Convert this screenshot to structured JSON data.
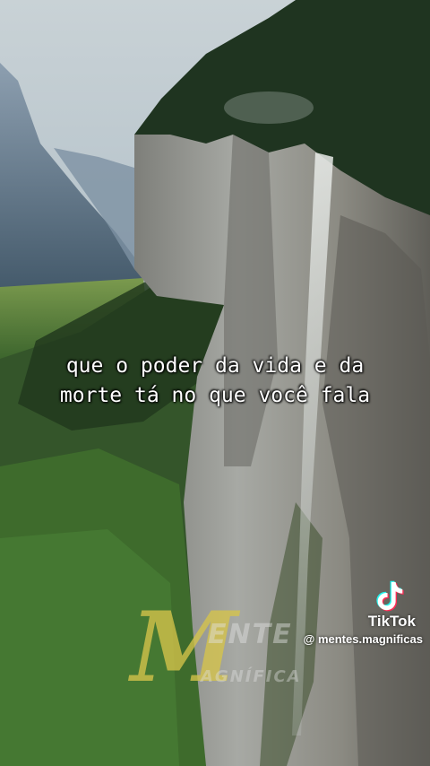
{
  "video": {
    "caption_lines": [
      "que o poder da vida e da",
      "morte tá no que você fala"
    ]
  },
  "watermark": {
    "initial": "M",
    "word_top": "ENTE",
    "word_bottom": "AGNÍFICA"
  },
  "tiktok": {
    "brand": "TikTok",
    "handle": "@ mentes.magnificas",
    "icon": "tiktok-logo-icon"
  },
  "colors": {
    "caption_text": "#ffffff",
    "watermark_gold": "#d6c44a",
    "tiktok_cyan": "#25f4ee",
    "tiktok_red": "#fe2c55"
  }
}
